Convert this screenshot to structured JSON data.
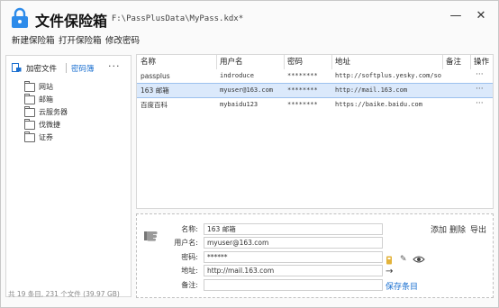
{
  "title": {
    "app_name": "文件保险箱",
    "file_path": "- F:\\PassPlusData\\MyPass.kdx*"
  },
  "window_controls": {
    "minimize": "—",
    "close": "✕"
  },
  "menu": [
    "新建保险箱",
    "打开保险箱",
    "修改密码"
  ],
  "sidebar": {
    "encrypt_file": "加密文件",
    "password_book": "密码簿",
    "more": "···",
    "items": [
      "网站",
      "邮箱",
      "云服务器",
      "伐微捷",
      "证券"
    ]
  },
  "table": {
    "headers": [
      "名称",
      "用户名",
      "密码",
      "地址",
      "备注",
      "操作"
    ],
    "rows": [
      {
        "name": "passplus",
        "username": "indroduce",
        "password": "********",
        "url": "http://softplus.yesky.com/so...",
        "note": "",
        "op": "···"
      },
      {
        "name": "163 邮箱",
        "username": "myuser@163.com",
        "password": "********",
        "url": "http://mail.163.com",
        "note": "",
        "op": "···"
      },
      {
        "name": "百度百科",
        "username": "mybaidu123",
        "password": "********",
        "url": "https://baike.baidu.com",
        "note": "",
        "op": "···"
      }
    ],
    "selected_index": 1
  },
  "detail": {
    "labels": {
      "name": "名称:",
      "username": "用户名:",
      "password": "密码:",
      "url": "地址:",
      "note": "备注:"
    },
    "values": {
      "name": "163 邮箱",
      "username": "myuser@163.com",
      "password": "******",
      "url": "http://mail.163.com",
      "note": ""
    },
    "actions": {
      "add": "添加",
      "delete": "删除",
      "export": "导出"
    },
    "arrow": "→",
    "save": "保存条目"
  },
  "status": "共 19 条目, 231 个文件 (39.97 GB)",
  "colors": {
    "accent": "#1a6fd0",
    "lock_blue": "#2d8bea",
    "selected_row": "#dbe9fb"
  }
}
